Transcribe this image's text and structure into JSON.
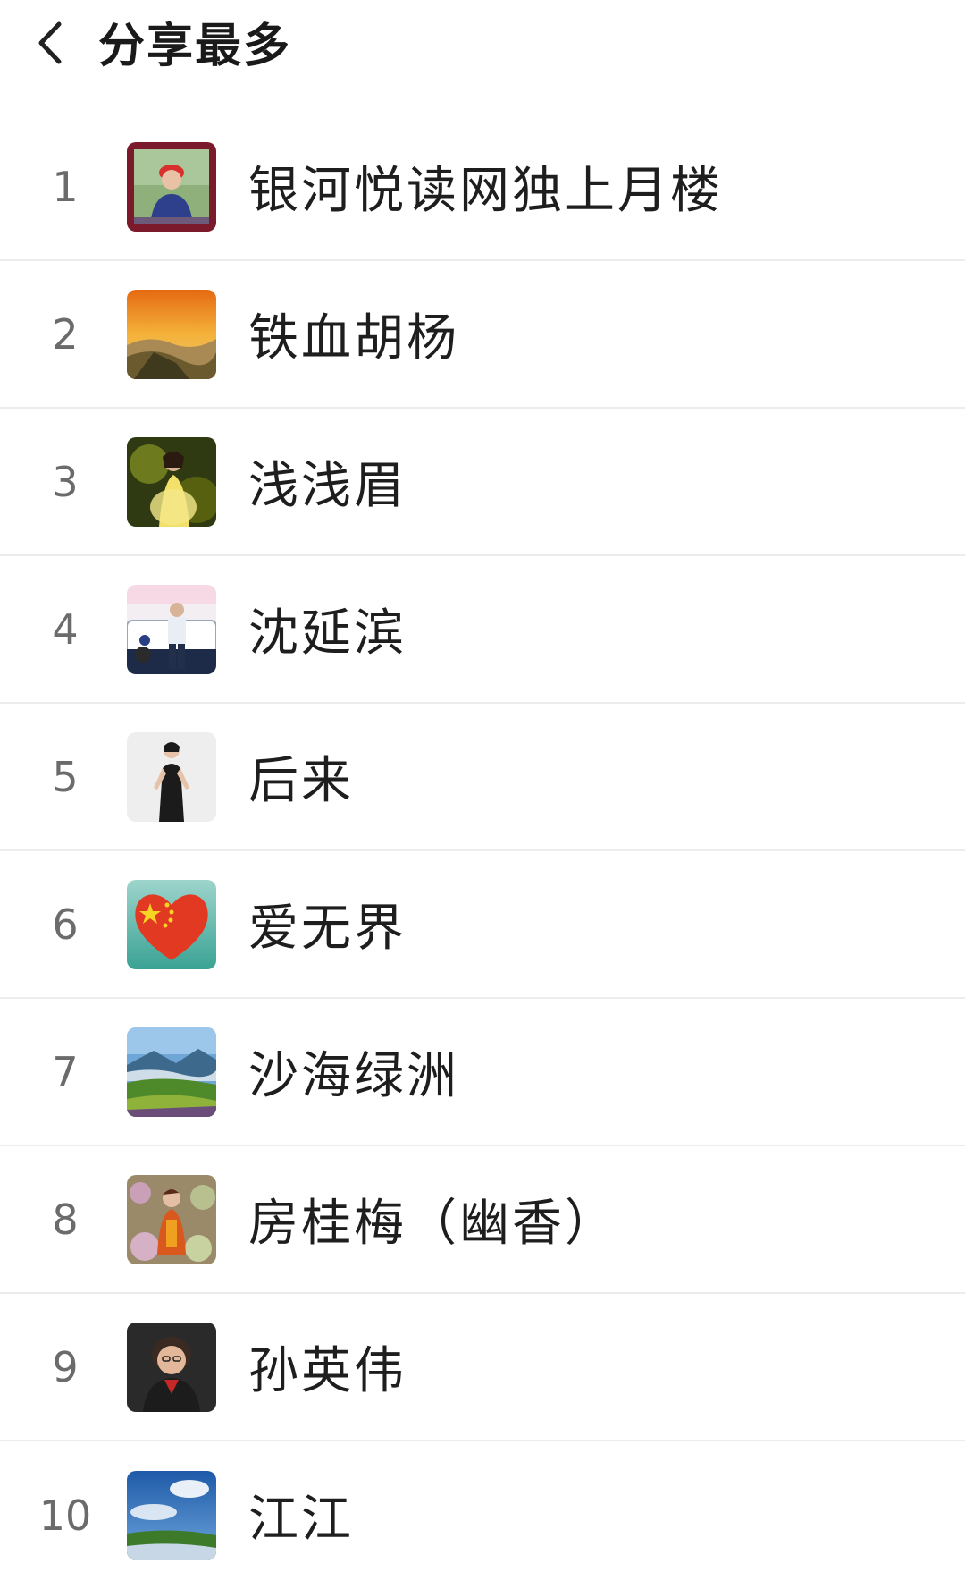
{
  "header": {
    "title": "分享最多"
  },
  "ranking": [
    {
      "rank": "1",
      "name": "银河悦读网独上月楼",
      "avatar": "portrait-red-hat-icon"
    },
    {
      "rank": "2",
      "name": "铁血胡杨",
      "avatar": "great-wall-sunset-icon"
    },
    {
      "rank": "3",
      "name": "浅浅眉",
      "avatar": "girl-yellow-dress-icon"
    },
    {
      "rank": "4",
      "name": "沈延滨",
      "avatar": "man-by-car-icon"
    },
    {
      "rank": "5",
      "name": "后来",
      "avatar": "woman-black-dress-icon"
    },
    {
      "rank": "6",
      "name": "爱无界",
      "avatar": "china-flag-heart-icon"
    },
    {
      "rank": "7",
      "name": "沙海绿洲",
      "avatar": "mountain-landscape-icon"
    },
    {
      "rank": "8",
      "name": "房桂梅（幽香）",
      "avatar": "woman-in-flowers-icon"
    },
    {
      "rank": "9",
      "name": "孙英伟",
      "avatar": "elderly-woman-portrait-icon"
    },
    {
      "rank": "10",
      "name": "江江",
      "avatar": "blue-sky-field-icon"
    }
  ]
}
